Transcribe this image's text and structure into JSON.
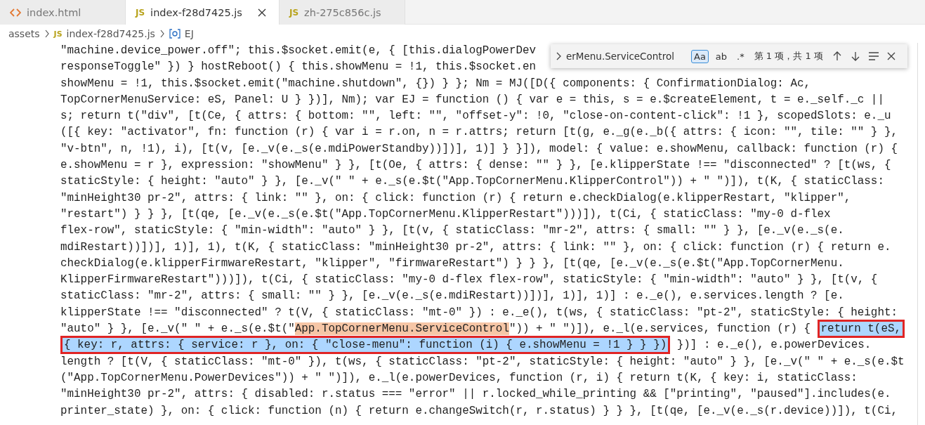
{
  "tabs": [
    {
      "kind": "html",
      "label": "index.html",
      "selected": false
    },
    {
      "kind": "js",
      "badge": "JS",
      "label": "index-f28d7425.js",
      "selected": true
    },
    {
      "kind": "js",
      "badge": "JS",
      "label": "zh-275c856c.js",
      "selected": false
    }
  ],
  "breadcrumb": [
    {
      "kind": "folder",
      "label": "assets"
    },
    {
      "kind": "js",
      "badge": "JS",
      "label": "index-f28d7425.js"
    },
    {
      "kind": "symbol",
      "label": "EJ"
    }
  ],
  "find": {
    "value": "erMenu.ServiceControl",
    "options": [
      {
        "label": "Aa",
        "selected": true
      },
      {
        "label": "ab",
        "selected": false
      },
      {
        "label": ".*",
        "selected": false
      }
    ],
    "result": "第 1 项，共 1 项"
  },
  "code": [
    [
      {
        "kind": "plain",
        "text": "\"machine.device_power.off\"; this.$socket.emit(e, { [this.dialogPowerDev"
      }
    ],
    [
      {
        "kind": "plain",
        "text": "responseToggle\" }) } hostReboot() { this.showMenu = !1, this.$socket.en"
      }
    ],
    [
      {
        "kind": "plain",
        "text": "showMenu = !1, this.$socket.emit(\"machine.shutdown\", {}) } }; Nm = MJ([D({ components: { ConfirmationDialog: Ac,"
      }
    ],
    [
      {
        "kind": "plain",
        "text": "TopCornerMenuService: eS, Panel: U } })], Nm); var EJ = function () { var e = this, s = e.$createElement, t = e._self._c ||"
      }
    ],
    [
      {
        "kind": "plain",
        "text": "s; return t(\"div\", [t(Ce, { attrs: { bottom: \"\", left: \"\", \"offset-y\": !0, \"close-on-content-click\": !1 }, scopedSlots: e._u"
      }
    ],
    [
      {
        "kind": "plain",
        "text": "([{ key: \"activator\", fn: function (r) { var i = r.on, n = r.attrs; return [t(g, e._g(e._b({ attrs: { icon: \"\", tile: \"\" } },"
      }
    ],
    [
      {
        "kind": "plain",
        "text": "\"v-btn\", n, !1), i), [t(v, [e._v(e._s(e.mdiPowerStandby))])], 1)] } }]), model: { value: e.showMenu, callback: function (r) {"
      }
    ],
    [
      {
        "kind": "plain",
        "text": "e.showMenu = r }, expression: \"showMenu\" } }, [t(Oe, { attrs: { dense: \"\" } }, [e.klipperState !== \"disconnected\" ? [t(ws, {"
      }
    ],
    [
      {
        "kind": "plain",
        "text": "staticStyle: { height: \"auto\" } }, [e._v(\" \" + e._s(e.$t(\"App.TopCornerMenu.KlipperControl\")) + \" \")]), t(K, { staticClass:"
      }
    ],
    [
      {
        "kind": "plain",
        "text": "\"minHeight30 pr-2\", attrs: { link: \"\" }, on: { click: function (r) { return e.checkDialog(e.klipperRestart, \"klipper\","
      }
    ],
    [
      {
        "kind": "plain",
        "text": "\"restart\") } } }, [t(qe, [e._v(e._s(e.$t(\"App.TopCornerMenu.KlipperRestart\")))]), t(Ci, { staticClass: \"my-0 d-flex"
      }
    ],
    [
      {
        "kind": "plain",
        "text": "flex-row\", staticStyle: { \"min-width\": \"auto\" } }, [t(v, { staticClass: \"mr-2\", attrs: { small: \"\" } }, [e._v(e._s(e."
      }
    ],
    [
      {
        "kind": "plain",
        "text": "mdiRestart))])], 1)], 1), t(K, { staticClass: \"minHeight30 pr-2\", attrs: { link: \"\" }, on: { click: function (r) { return e."
      }
    ],
    [
      {
        "kind": "plain",
        "text": "checkDialog(e.klipperFirmwareRestart, \"klipper\", \"firmwareRestart\") } } }, [t(qe, [e._v(e._s(e.$t(\"App.TopCornerMenu."
      }
    ],
    [
      {
        "kind": "plain",
        "text": "KlipperFirmwareRestart\")))]), t(Ci, { staticClass: \"my-0 d-flex flex-row\", staticStyle: { \"min-width\": \"auto\" } }, [t(v, {"
      }
    ],
    [
      {
        "kind": "plain",
        "text": "staticClass: \"mr-2\", attrs: { small: \"\" } }, [e._v(e._s(e.mdiRestart))])], 1)], 1)] : e._e(), e.services.length ? [e."
      }
    ],
    [
      {
        "kind": "plain",
        "text": "klipperState !== \"disconnected\" ? t(V, { staticClass: \"mt-0\" }) : e._e(), t(ws, { staticClass: \"pt-2\", staticStyle: { height:"
      }
    ],
    [
      {
        "kind": "plain",
        "text": "\"auto\" } }, [e._v(\" \" + e._s(e.$t(\""
      },
      {
        "kind": "match",
        "text": "App.TopCornerMenu.ServiceControl"
      },
      {
        "kind": "plain",
        "text": "\")) + \" \")]), e._l(e.services, function (r) { "
      },
      {
        "kind": "selection",
        "outlined": true,
        "text": "return t(eS,"
      }
    ],
    [
      {
        "kind": "selection",
        "outlined": true,
        "text": "{ key: r, attrs: { service: r }, on: { \"close-menu\": function (i) { e.showMenu = !1 } } })"
      },
      {
        "kind": "plain",
        "text": " })] : e._e(), e.powerDevices."
      }
    ],
    [
      {
        "kind": "plain",
        "text": "length ? [t(V, { staticClass: \"mt-0\" }), t(ws, { staticClass: \"pt-2\", staticStyle: { height: \"auto\" } }, [e._v(\" \" + e._s(e.$t"
      }
    ],
    [
      {
        "kind": "plain",
        "text": "(\"App.TopCornerMenu.PowerDevices\")) + \" \")]), e._l(e.powerDevices, function (r, i) { return t(K, { key: i, staticClass:"
      }
    ],
    [
      {
        "kind": "plain",
        "text": "\"minHeight30 pr-2\", attrs: { disabled: r.status === \"error\" || r.locked_while_printing && [\"printing\", \"paused\"].includes(e."
      }
    ],
    [
      {
        "kind": "plain",
        "text": "printer_state) }, on: { click: function (n) { return e.changeSwitch(r, r.status) } } }, [t(qe, [e._v(e._s(r.device))]), t(Ci,"
      }
    ]
  ]
}
